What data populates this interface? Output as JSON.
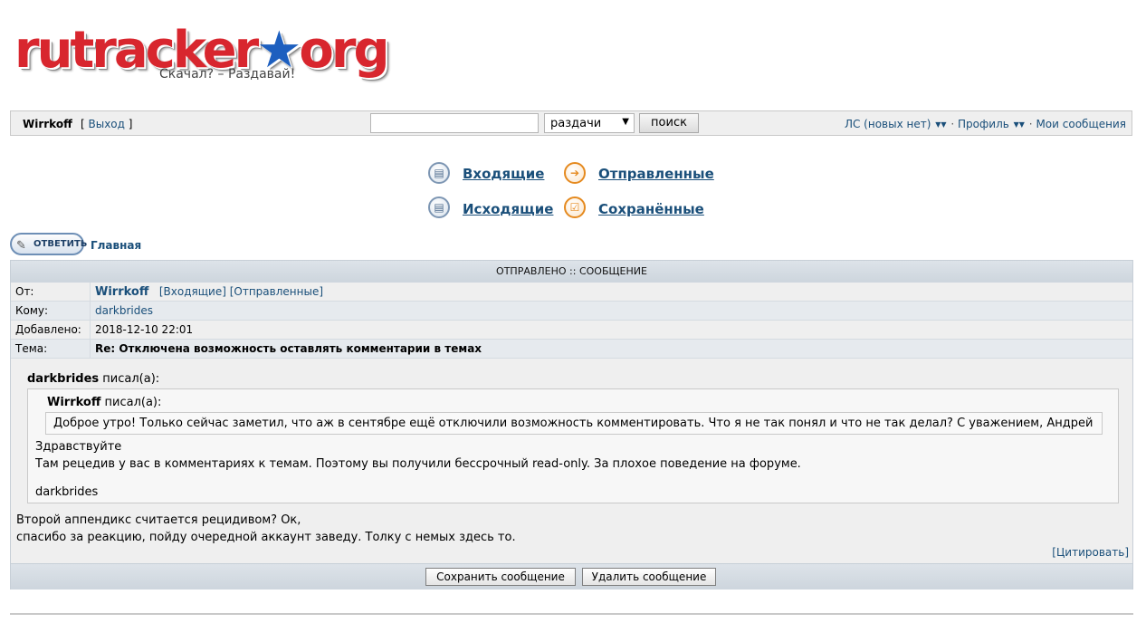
{
  "logo": {
    "word_main": "rutracker",
    "word_dot": "★",
    "word_org": "org",
    "slogan": "Скачал? – Раздавай!"
  },
  "topbar": {
    "username": "Wirrkoff",
    "logout_open": "[ ",
    "logout_label": "Выход",
    "logout_close": " ]",
    "search": {
      "value": "",
      "placeholder": ""
    },
    "select_value": "раздачи",
    "search_button": "поиск",
    "links": {
      "pm": "ЛС (новых нет)",
      "profile": "Профиль",
      "my_posts": "Мои сообщения",
      "sep": "·"
    }
  },
  "folders": {
    "inbox": "Входящие",
    "sent": "Отправленные",
    "outbox": "Исходящие",
    "saved": "Сохранённые"
  },
  "reply_button": "ОТВЕТИТЬ",
  "breadcrumb": "Главная",
  "message": {
    "header": "ОТПРАВЛЕНО :: СООБЩЕНИЕ",
    "from_label": "От:",
    "from_user": "Wirrkoff",
    "from_inbox_link": "[Входящие]",
    "from_sent_link": "[Отправленные]",
    "to_label": "Кому:",
    "to_user": "darkbrides",
    "date_label": "Добавлено:",
    "date_value": "2018-12-10 22:01",
    "subject_label": "Тема:",
    "subject_value": "Re: Отключена возможность оставлять комментарии в темах",
    "quote1": {
      "author": "darkbrides",
      "wrote": " писал(а):",
      "lines": [
        "Здравствуйте",
        "Там рецедив у вас в комментариях к темам. Поэтому вы получили бессрочный read-only. За плохое поведение на форуме.",
        "darkbrides"
      ]
    },
    "quote2": {
      "author": "Wirrkoff",
      "wrote": " писал(а):",
      "text": "Доброе утро! Только сейчас заметил, что аж в сентябре ещё отключили возможность комментировать. Что я не так понял и что не так делал? С уважением, Андрей"
    },
    "body_lines": [
      "Второй аппендикс считается рецидивом? Ок,",
      "спасибо за реакцию, пойду очередной аккаунт заведу. Толку с немых здесь то."
    ],
    "quote_link": "[Цитировать]",
    "save_button": "Сохранить сообщение",
    "delete_button": "Удалить сообщение"
  },
  "colors": {
    "link": "#1a4f7a",
    "logo_red": "#d8262e",
    "logo_blue": "#1d5fbf",
    "header_bg": "#cdd5dd"
  },
  "icons": {
    "inbox": "inbox-folder-icon",
    "sent": "sent-arrow-icon",
    "outbox": "outbox-folder-icon",
    "saved": "saved-check-icon",
    "caret": "chevron-down-icon"
  }
}
